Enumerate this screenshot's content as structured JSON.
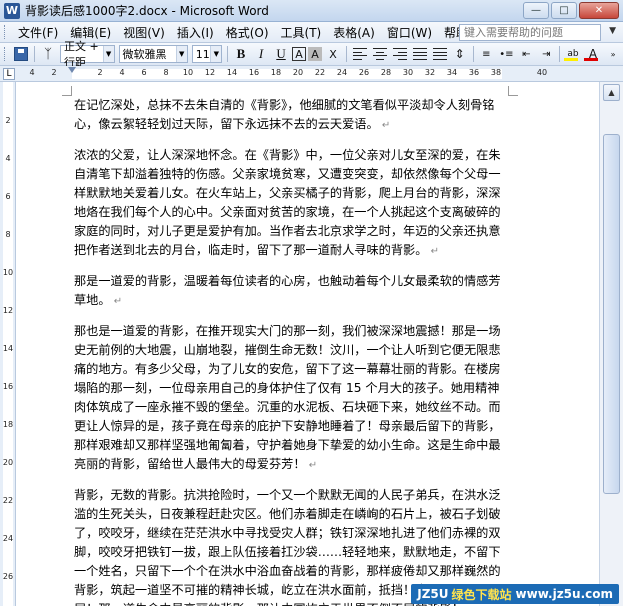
{
  "window": {
    "title": "背影读后感1000字2.docx - Microsoft Word",
    "app_icon": "W"
  },
  "menu": {
    "items": [
      "文件(F)",
      "编辑(E)",
      "视图(V)",
      "插入(I)",
      "格式(O)",
      "工具(T)",
      "表格(A)",
      "窗口(W)",
      "帮助(H)"
    ],
    "help_placeholder": "键入需要帮助的问题"
  },
  "toolbar": {
    "style": "正文 + 行距",
    "font": "微软雅黑",
    "size": "11",
    "bold": "B",
    "italic": "I",
    "underline": "U",
    "char_border": "A",
    "char_shading": "A",
    "char_scale": "X",
    "highlight": "ab",
    "font_color": "A"
  },
  "ruler": {
    "numbers": [
      "4",
      "2",
      "2",
      "4",
      "6",
      "8",
      "10",
      "12",
      "14",
      "16",
      "18",
      "20",
      "22",
      "24",
      "26",
      "28",
      "30",
      "32",
      "34",
      "36",
      "38",
      "40"
    ],
    "vnumbers": [
      "2",
      "4",
      "6",
      "8",
      "10",
      "12",
      "14",
      "16",
      "18",
      "20",
      "22",
      "24",
      "26"
    ]
  },
  "document": {
    "paragraphs": [
      "在记忆深处，总抹不去朱自清的《背影》，他细腻的文笔看似平淡却令人刻骨铭心，像云絮轻轻划过天际，留下永远抹不去的云天爱语。",
      "浓浓的父爱，让人深深地怀念。在《背影》中，一位父亲对儿女至深的爱，在朱自清笔下却溢着独特的伤感。父亲家境贫寒，又遭变突变，却依然像每个父母一样默默地关爱着儿女。在火车站上，父亲买橘子的背影，爬上月台的背影，深深地烙在我们每个人的心中。父亲面对贫苦的家境，在一个人挑起这个支离破碎的家庭的同时，对儿子更是爱护有加。当作者去北京求学之时，年迈的父亲还执意把作者送到北去的月台，临走时，留下了那一道耐人寻味的背影。",
      "那是一道爱的背影，温暖着每位读者的心房，也触动着每个儿女最柔软的情感芳草地。",
      "那也是一道爱的背影，在推开现实大门的那一刻，我们被深深地震撼！那是一场史无前例的大地震，山崩地裂，摧倒生命无数！汶川，一个让人听到它便无限悲痛的地方。有多少父母，为了儿女的安危，留下了这一幕幕壮丽的背影。在楼房塌陷的那一刻，一位母亲用自己的身体护住了仅有 15 个月大的孩子。她用精神肉体筑成了一座永摧不毁的堡垒。沉重的水泥板、石块砸下来，她纹丝不动。而更让人惊异的是，孩子竟在母亲的庇护下安静地睡着了！母亲最后留下的背影，那样艰难却又那样坚强地匍匐着，守护着她身下挚爱的幼小生命。这是生命中最亮丽的背影，留给世人最伟大的母爱芬芳！",
      "背影，无数的背影。抗洪抢险时，一个又一个默默无闻的人民子弟兵，在洪水泛滥的生死关头，日夜兼程赶赴灾区。他们赤着脚走在嶙峋的石片上，被石子划破了，咬咬牙，继续在茫茫洪水中寻找受灾人群；铁钉深深地扎进了他们赤裸的双脚，咬咬牙把铁钉一拔，跟上队伍接着扛沙袋……轻轻地来，默默地走，不留下一个姓名，只留下一个个在洪水中浴血奋战着的背影，那样疲倦却又那样巍然的背影，筑起一道坚不可摧的精神长城，屹立在洪水面前，抵挡！奋进！无畏！不屈！那一道生命中最亮丽的背影，那让中国屹立于世界不倒不屈的背影！"
    ]
  },
  "watermark": {
    "prefix": "JZ5U",
    "accent": "绿色下载站",
    "suffix": "www.jz5u.com"
  }
}
